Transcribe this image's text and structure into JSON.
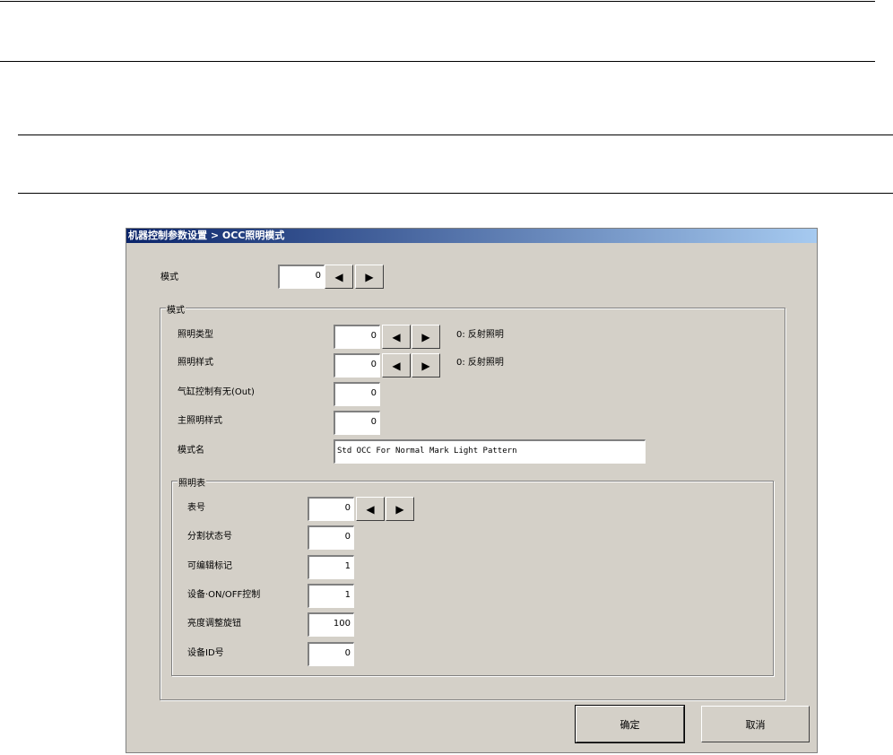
{
  "window": {
    "title": "机器控制参数设置 > OCC照明模式"
  },
  "mode": {
    "label": "模式",
    "value": "0"
  },
  "mode_group": {
    "legend": "模式",
    "lighting_type": {
      "label": "照明类型",
      "value": "0",
      "desc": "0: 反射照明"
    },
    "lighting_style": {
      "label": "照明样式",
      "value": "0",
      "desc": "0: 反射照明"
    },
    "cylinder": {
      "label": "气缸控制有无(Out)",
      "value": "0"
    },
    "main_style": {
      "label": "主照明样式",
      "value": "0"
    },
    "mode_name": {
      "label": "模式名",
      "value": "Std OCC For Normal Mark Light Pattern"
    }
  },
  "table_group": {
    "legend": "照明表",
    "rows": [
      {
        "label": "表号",
        "value": "0"
      },
      {
        "label": "分割状态号",
        "value": "0"
      },
      {
        "label": "可编辑标记",
        "value": "1"
      },
      {
        "label": "设备·ON/OFF控制",
        "value": "1"
      },
      {
        "label": "亮度调整旋钮",
        "value": "100"
      },
      {
        "label": "设备ID号",
        "value": "0"
      }
    ]
  },
  "buttons": {
    "ok": "确定",
    "cancel": "取消"
  },
  "icons": {
    "left": "◀",
    "right": "▶"
  }
}
